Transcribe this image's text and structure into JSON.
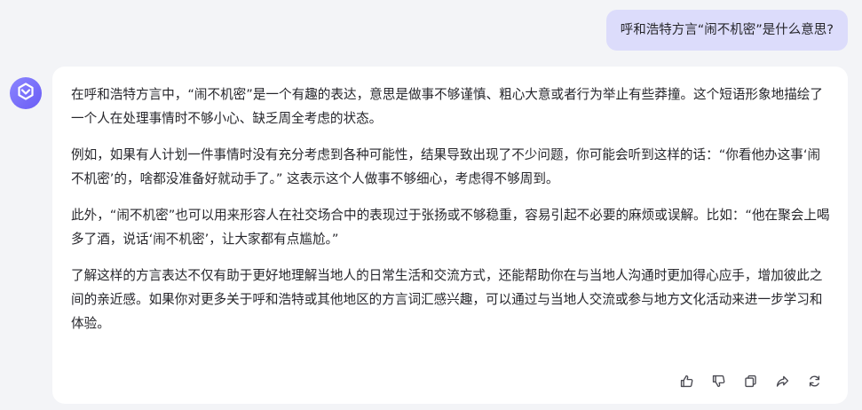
{
  "user_message": {
    "text": "呼和浩特方言“闹不机密”是什么意思?"
  },
  "assistant": {
    "avatar_icon": "assistant-logo-icon",
    "accent_color": "#7b73fb",
    "paragraphs": [
      "在呼和浩特方言中，“闹不机密”是一个有趣的表达，意思是做事不够谨慎、粗心大意或者行为举止有些莽撞。这个短语形象地描绘了一个人在处理事情时不够小心、缺乏周全考虑的状态。",
      "例如，如果有人计划一件事情时没有充分考虑到各种可能性，结果导致出现了不少问题，你可能会听到这样的话：“你看他办这事‘闹不机密’的，啥都没准备好就动手了。” 这表示这个人做事不够细心，考虑得不够周到。",
      "此外，“闹不机密”也可以用来形容人在社交场合中的表现过于张扬或不够稳重，容易引起不必要的麻烦或误解。比如：“他在聚会上喝多了酒，说话‘闹不机密’，让大家都有点尴尬。”",
      "了解这样的方言表达不仅有助于更好地理解当地人的日常生活和交流方式，还能帮助你在与当地人沟通时更加得心应手，增加彼此之间的亲近感。如果你对更多关于呼和浩特或其他地区的方言词汇感兴趣，可以通过与当地人交流或参与地方文化活动来进一步学习和体验。"
    ]
  },
  "toolbar": {
    "icons": [
      "thumbs-up-icon",
      "thumbs-down-icon",
      "copy-icon",
      "share-icon",
      "regenerate-icon"
    ]
  },
  "colors": {
    "page_background": "#f3f4f7",
    "user_bubble": "#dcdcfb",
    "card_background": "#ffffff",
    "text": "#26262b"
  }
}
